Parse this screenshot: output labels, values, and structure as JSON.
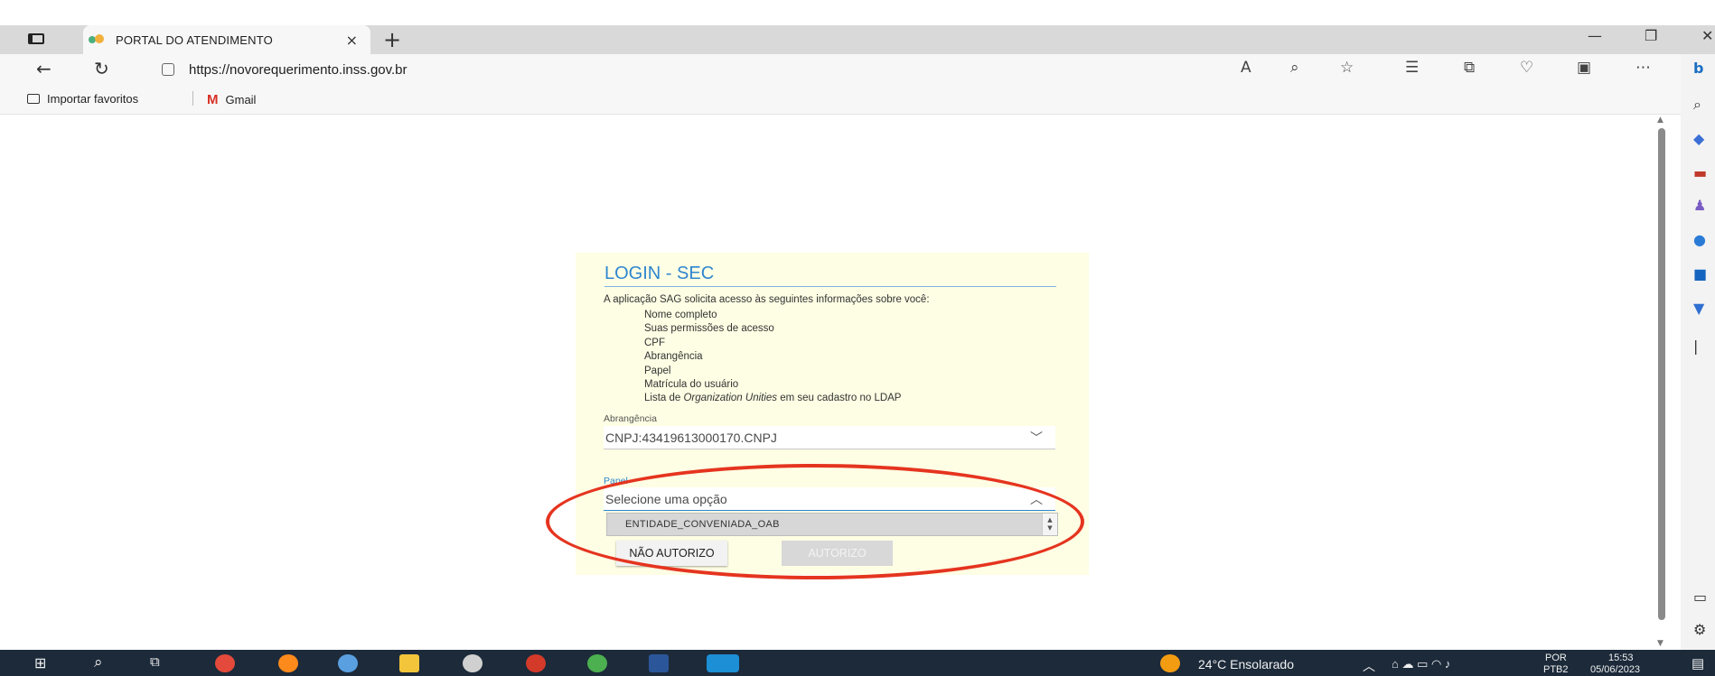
{
  "browser": {
    "tab_title": "PORTAL DO ATENDIMENTO",
    "tab_close": "×",
    "new_tab": "+",
    "url": "https://novorequerimento.inss.gov.br",
    "favorites": [
      {
        "label": "Importar favoritos"
      },
      {
        "label": "Gmail"
      }
    ]
  },
  "login": {
    "title": "LOGIN - SEC",
    "description": "A aplicação SAG solicita acesso às seguintes informações sobre você:",
    "permissions": [
      "Nome completo",
      "Suas permissões de acesso",
      "CPF",
      "Abrangência",
      "Papel",
      "Matrícula do usuário"
    ],
    "permission_last_prefix": "Lista de ",
    "permission_last_italic": "Organization Unities",
    "permission_last_suffix": " em seu cadastro no LDAP",
    "abrangencia_label": "Abrangência",
    "abrangencia_value": "CNPJ:43419613000170.CNPJ",
    "papel_label": "Papel",
    "papel_value": "Selecione uma opção",
    "papel_option": "ENTIDADE_CONVENIADA_OAB",
    "deny_button": "NÃO AUTORIZO",
    "allow_button": "AUTORIZO"
  },
  "taskbar": {
    "weather": "24°C  Ensolarado",
    "lang_top": "POR",
    "lang_bottom": "PTB2",
    "time": "15:53",
    "date": "05/06/2023"
  },
  "colors": {
    "panel_bg": "#fefee4",
    "title_blue": "#2f86d0",
    "highlight_red": "#e5341f",
    "taskbar": "#1c2a3a"
  }
}
